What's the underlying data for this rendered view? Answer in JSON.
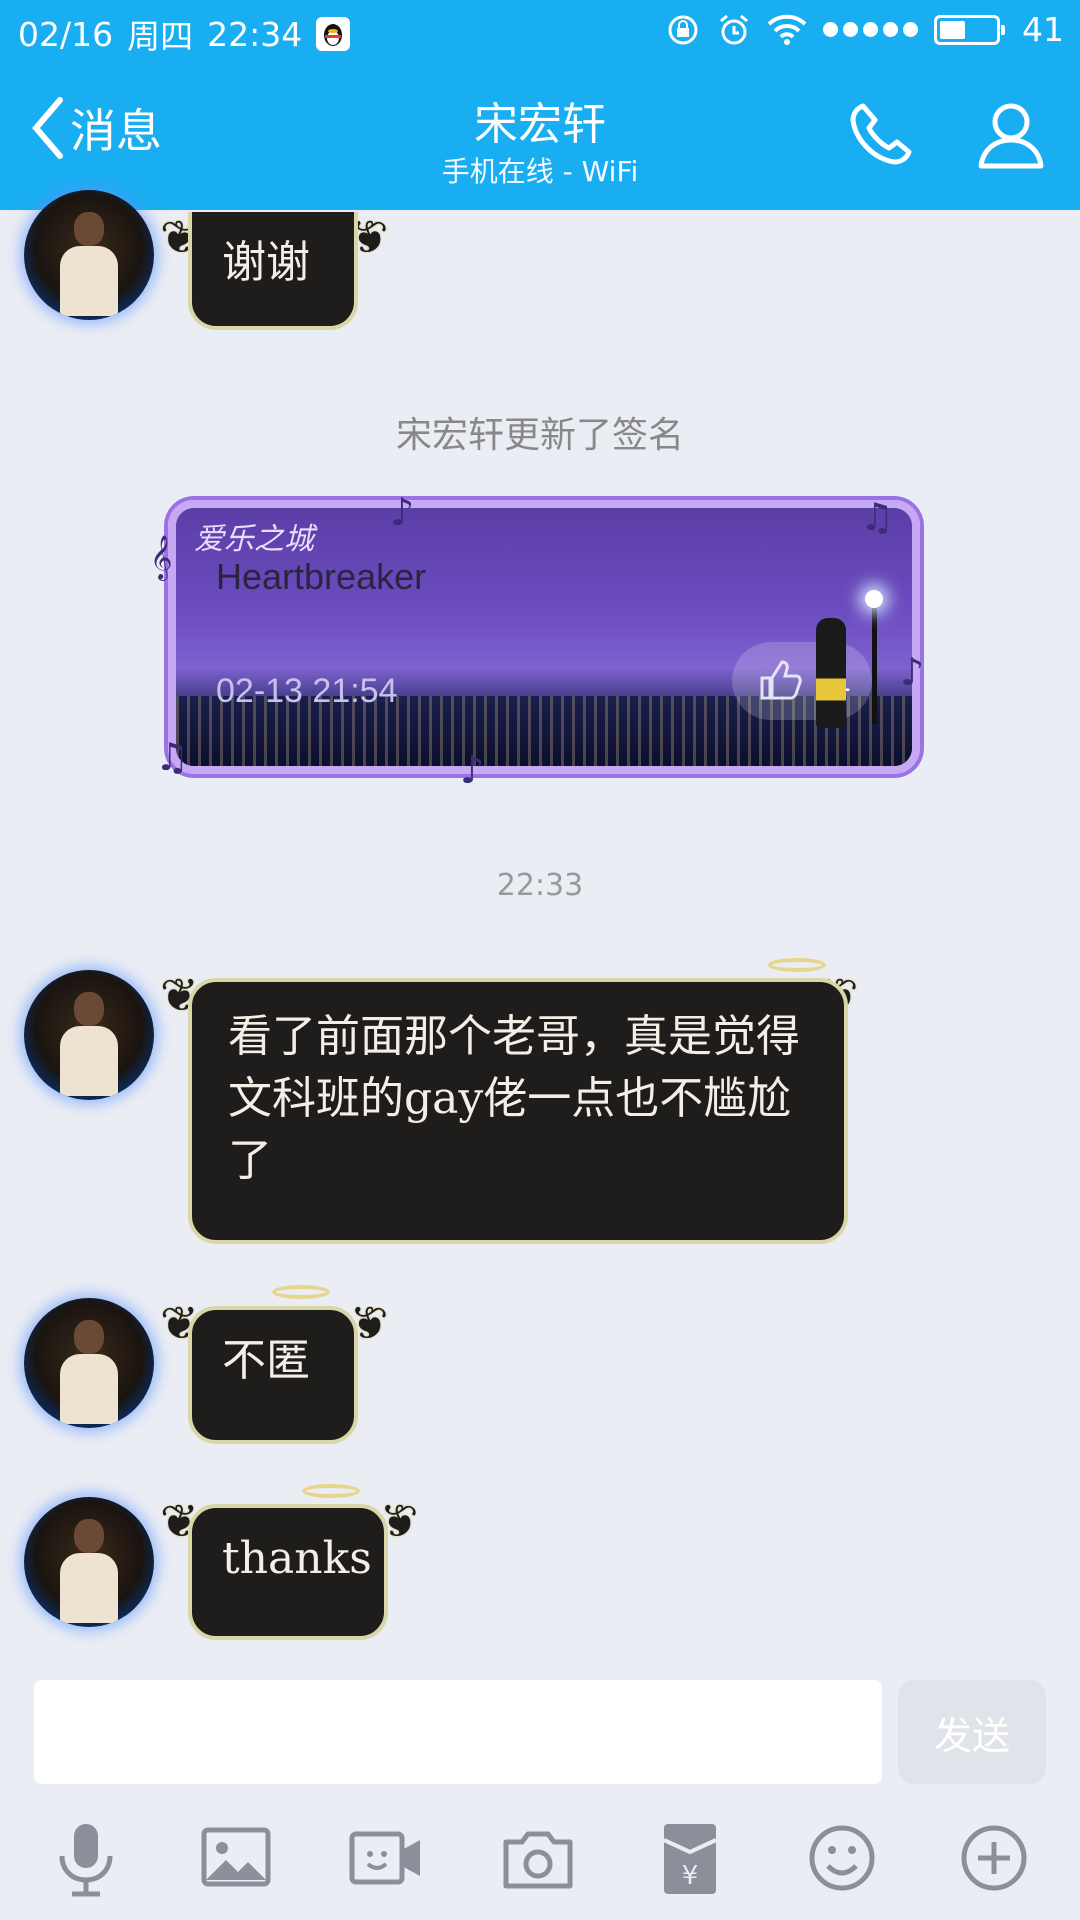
{
  "status": {
    "date": "02/16",
    "weekday": "周四",
    "time": "22:34",
    "battery": "41"
  },
  "header": {
    "back_label": "消息",
    "title": "宋宏轩",
    "subtitle": "手机在线 - WiFi"
  },
  "messages": [
    {
      "text": "谢谢"
    },
    {
      "text": "看了前面那个老哥，真是觉得文科班的gay佬一点也不尴尬了"
    },
    {
      "text": "不匿"
    },
    {
      "text": "thanks"
    }
  ],
  "system_notice": "宋宏轩更新了签名",
  "timestamp": "22:33",
  "signature_card": {
    "logo": "爱乐之城",
    "title": "Heartbreaker",
    "date": "02-13 21:54",
    "like_count": "1"
  },
  "input": {
    "send_label": "发送"
  },
  "toolbar": [
    "microphone-icon",
    "image-icon",
    "video-call-icon",
    "camera-icon",
    "red-packet-icon",
    "emoji-icon",
    "plus-icon"
  ],
  "colors": {
    "header": "#19adf1",
    "bubble": "#1f1c1c",
    "bubble_border": "#d9d7a8",
    "chat_bg": "#ebedf4"
  }
}
